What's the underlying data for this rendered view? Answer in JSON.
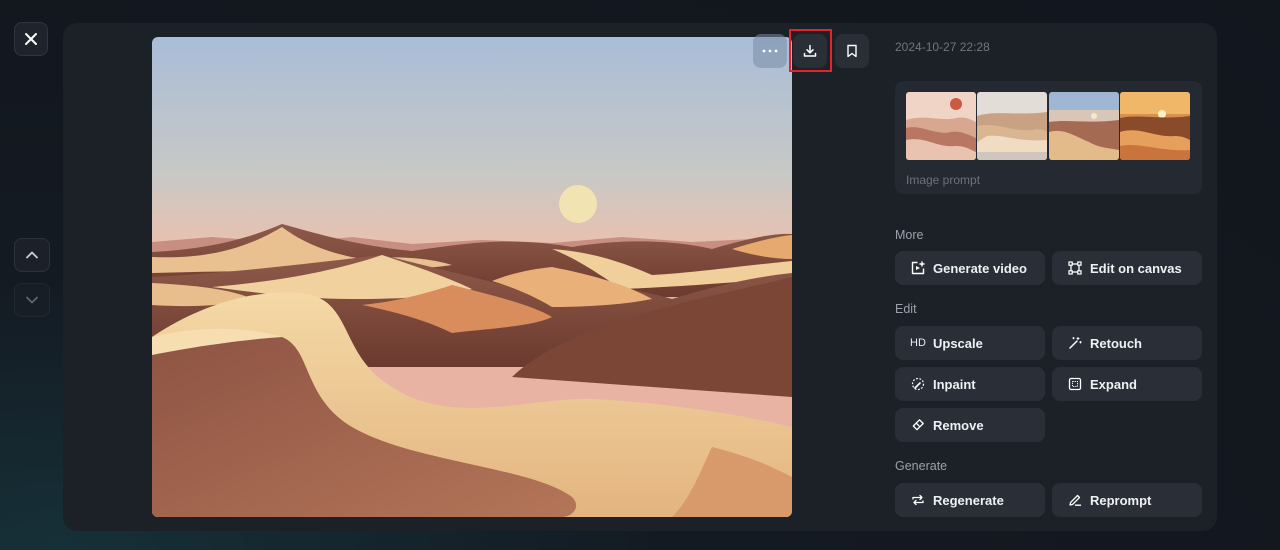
{
  "image": {
    "alt": "",
    "timestamp": "2024-10-27 22:28"
  },
  "toolbar": {
    "more_icon": "more-horizontal-icon",
    "download_icon": "download-icon",
    "bookmark_icon": "bookmark-icon"
  },
  "prompt": {
    "label": "Image prompt",
    "thumbnails": [
      "thumb-1",
      "thumb-2",
      "thumb-3",
      "thumb-4"
    ]
  },
  "sections": {
    "more": {
      "title": "More",
      "actions": [
        {
          "label": "Generate video",
          "icon": "video-plus-icon"
        },
        {
          "label": "Edit on canvas",
          "icon": "canvas-icon"
        }
      ]
    },
    "edit": {
      "title": "Edit",
      "actions": [
        {
          "label": "Upscale",
          "icon": "hd-icon",
          "icon_text": "HD"
        },
        {
          "label": "Retouch",
          "icon": "magic-wand-icon"
        },
        {
          "label": "Inpaint",
          "icon": "inpaint-icon"
        },
        {
          "label": "Expand",
          "icon": "expand-icon"
        },
        {
          "label": "Remove",
          "icon": "eraser-icon"
        }
      ]
    },
    "generate": {
      "title": "Generate",
      "actions": [
        {
          "label": "Regenerate",
          "icon": "regenerate-icon"
        },
        {
          "label": "Reprompt",
          "icon": "pencil-icon"
        }
      ]
    }
  },
  "colors": {
    "modal_bg": "#1c2027",
    "button_bg": "#2a2f37",
    "highlight": "#e5232f"
  }
}
